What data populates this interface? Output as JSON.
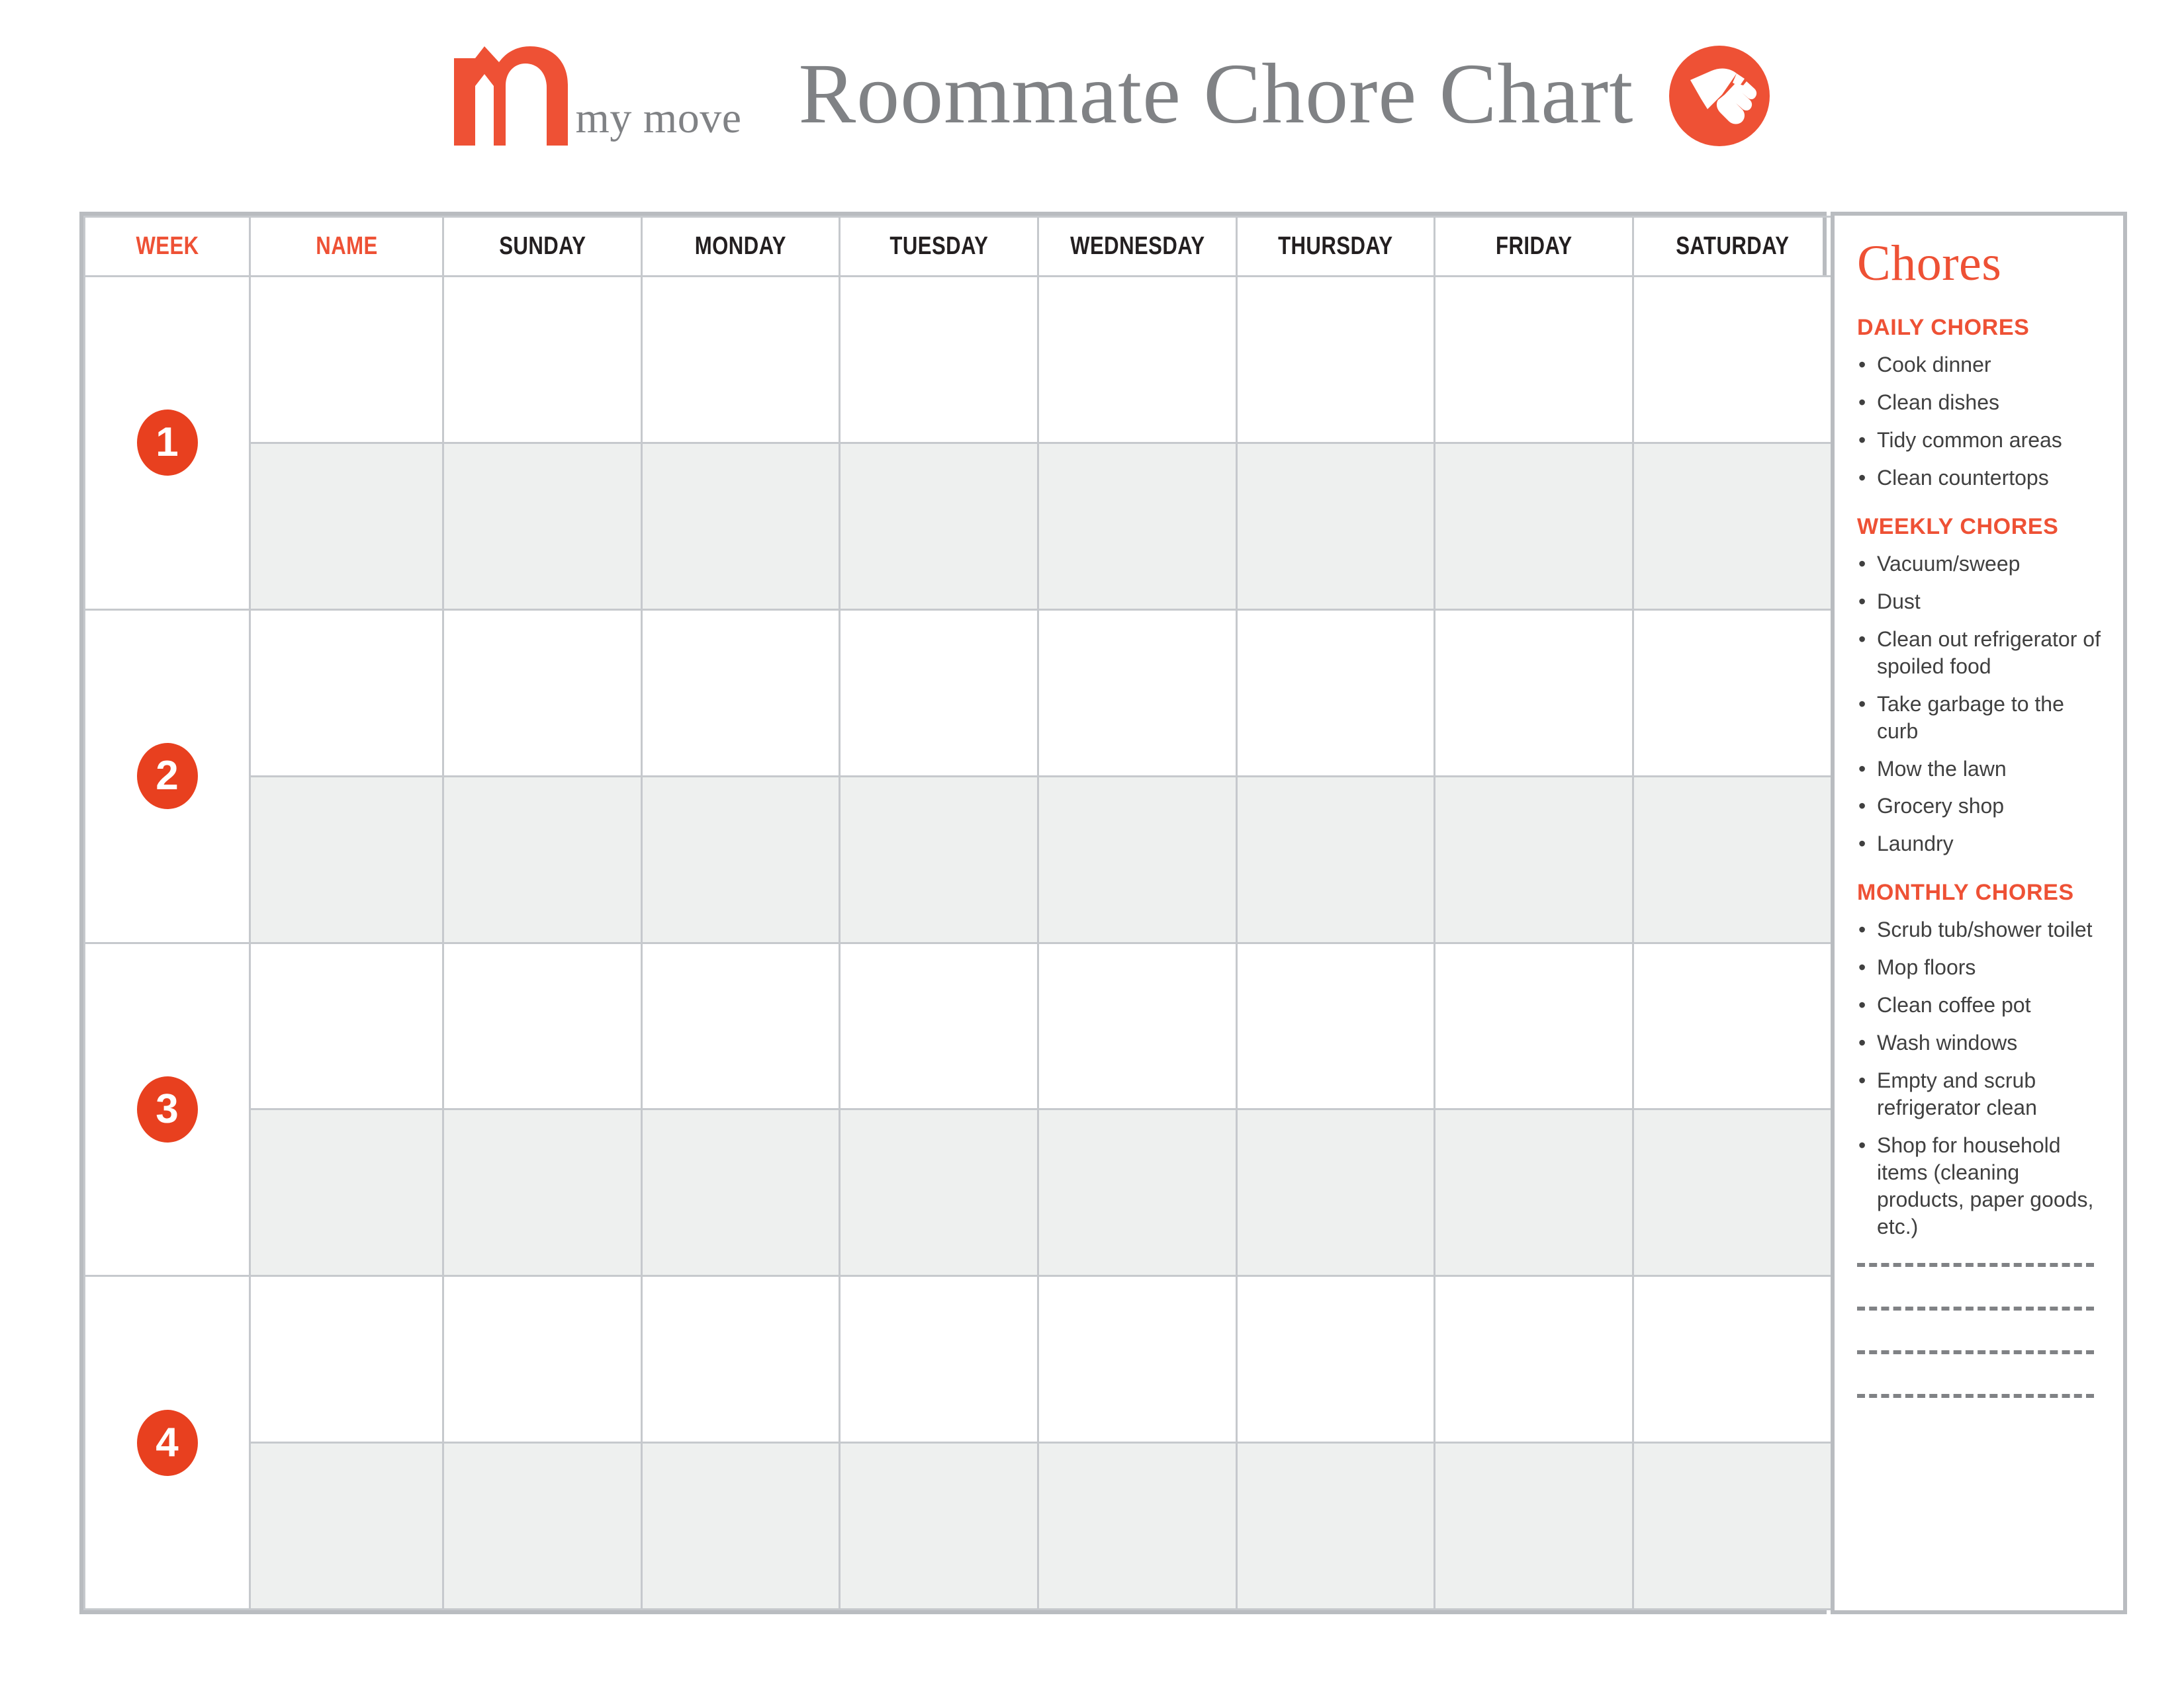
{
  "header": {
    "logo_icon": "mymove-m-logo-icon",
    "logo_wordmark": "my move",
    "title": "Roommate Chore Chart",
    "badge_icon": "cleaning-hand-wiping-icon",
    "accent_color": "#EE5135",
    "title_color": "#808285"
  },
  "table": {
    "columns": [
      {
        "key": "week",
        "label": "WEEK",
        "accent": true
      },
      {
        "key": "name",
        "label": "NAME",
        "accent": true
      },
      {
        "key": "sunday",
        "label": "SUNDAY",
        "accent": false
      },
      {
        "key": "monday",
        "label": "MONDAY",
        "accent": false
      },
      {
        "key": "tuesday",
        "label": "TUESDAY",
        "accent": false
      },
      {
        "key": "wednesday",
        "label": "WEDNESDAY",
        "accent": false
      },
      {
        "key": "thursday",
        "label": "THURSDAY",
        "accent": false
      },
      {
        "key": "friday",
        "label": "FRIDAY",
        "accent": false
      },
      {
        "key": "saturday",
        "label": "SATURDAY",
        "accent": false
      }
    ],
    "weeks": [
      {
        "number": "1",
        "rows": [
          "",
          ""
        ]
      },
      {
        "number": "2",
        "rows": [
          "",
          ""
        ]
      },
      {
        "number": "3",
        "rows": [
          "",
          ""
        ]
      },
      {
        "number": "4",
        "rows": [
          "",
          ""
        ]
      }
    ],
    "shade_color": "#EEF0EF",
    "border_color": "#c6c9cd"
  },
  "chores": {
    "heading": "Chores",
    "groups": [
      {
        "title": "DAILY CHORES",
        "items": [
          "Cook dinner",
          "Clean dishes",
          "Tidy common areas",
          "Clean countertops"
        ]
      },
      {
        "title": "WEEKLY CHORES",
        "items": [
          "Vacuum/sweep",
          "Dust",
          "Clean out refrigerator of spoiled food",
          "Take garbage to the curb",
          "Mow the lawn",
          "Grocery shop",
          "Laundry"
        ]
      },
      {
        "title": "MONTHLY CHORES",
        "items": [
          "Scrub tub/shower toilet",
          "Mop floors",
          "Clean coffee pot",
          "Wash windows",
          "Empty and scrub refrigerator clean",
          "Shop for household items (cleaning products, paper goods, etc.)"
        ]
      }
    ],
    "write_in_lines": 4
  }
}
